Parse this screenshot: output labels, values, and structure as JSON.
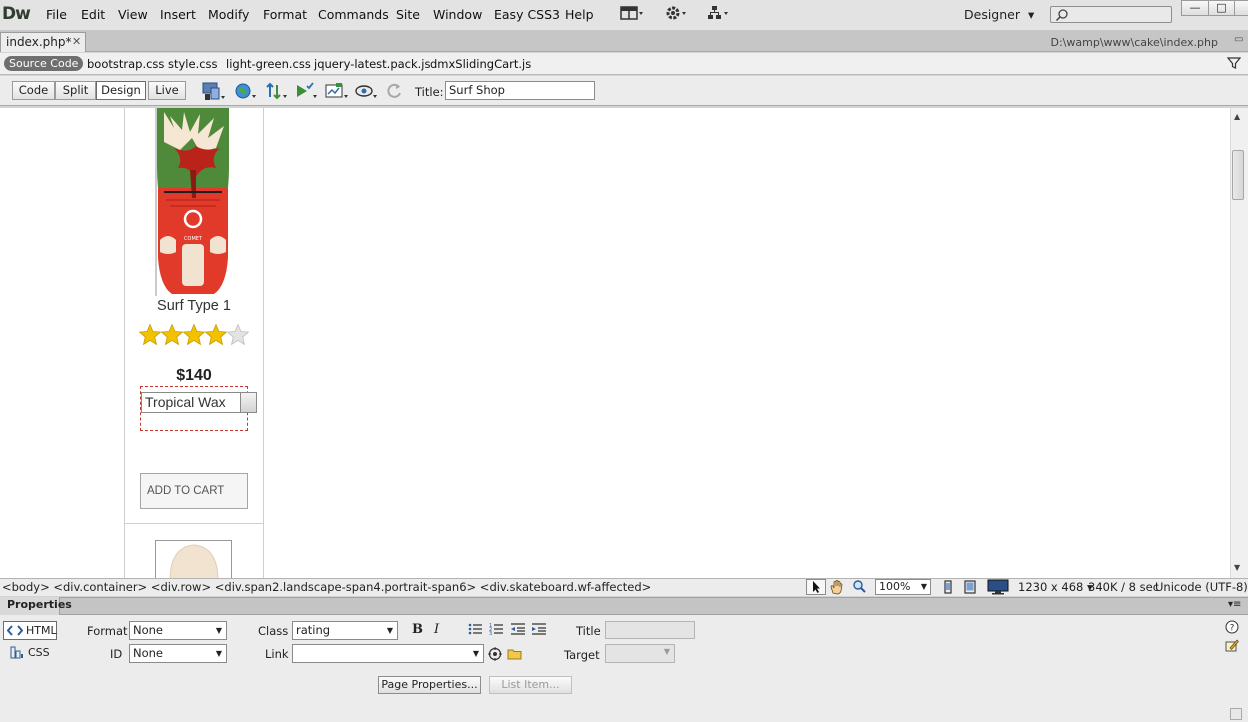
{
  "app": {
    "logo": "Dw"
  },
  "menu": [
    "File",
    "Edit",
    "View",
    "Insert",
    "Modify",
    "Format",
    "Commands",
    "Site",
    "Window",
    "Easy CSS3",
    "Help"
  ],
  "workspace": {
    "label": "Designer"
  },
  "document": {
    "tab_label": "index.php*",
    "path": "D:\\wamp\\www\\cake\\index.php"
  },
  "related_files": {
    "source_label": "Source Code",
    "files": [
      "bootstrap.css",
      "style.css",
      "light-green.css",
      "jquery-latest.pack.js",
      "dmxSlidingCart.js"
    ]
  },
  "doc_toolbar": {
    "views": [
      "Code",
      "Split",
      "Design",
      "Live"
    ],
    "active_view": "Design",
    "title_label": "Title:",
    "title_value": "Surf Shop"
  },
  "product": {
    "name": "Surf Type 1",
    "rating": 4,
    "rating_max": 5,
    "price": "$140",
    "option_selected": "Tropical Wax",
    "cart_button": "ADD TO CART"
  },
  "status": {
    "tag_selector": "<body> <div.container> <div.row> <div.span2.landscape-span4.portrait-span6> <div.skateboard.wf-affected>",
    "zoom": "100%",
    "dimensions": "1230 x 468",
    "download": "340K / 8 sec",
    "encoding": "Unicode (UTF-8)"
  },
  "properties": {
    "tab": "Properties",
    "html_label": "HTML",
    "css_label": "CSS",
    "format_label": "Format",
    "format_value": "None",
    "id_label": "ID",
    "id_value": "None",
    "class_label": "Class",
    "class_value": "rating",
    "link_label": "Link",
    "link_value": "",
    "title_label": "Title",
    "target_label": "Target",
    "page_properties": "Page Properties...",
    "list_item": "List Item..."
  },
  "colors": {
    "board_green": "#4f8a3a",
    "board_red": "#e23a2a",
    "star": "#f2c200",
    "dashed_outline": "#c0392b"
  }
}
